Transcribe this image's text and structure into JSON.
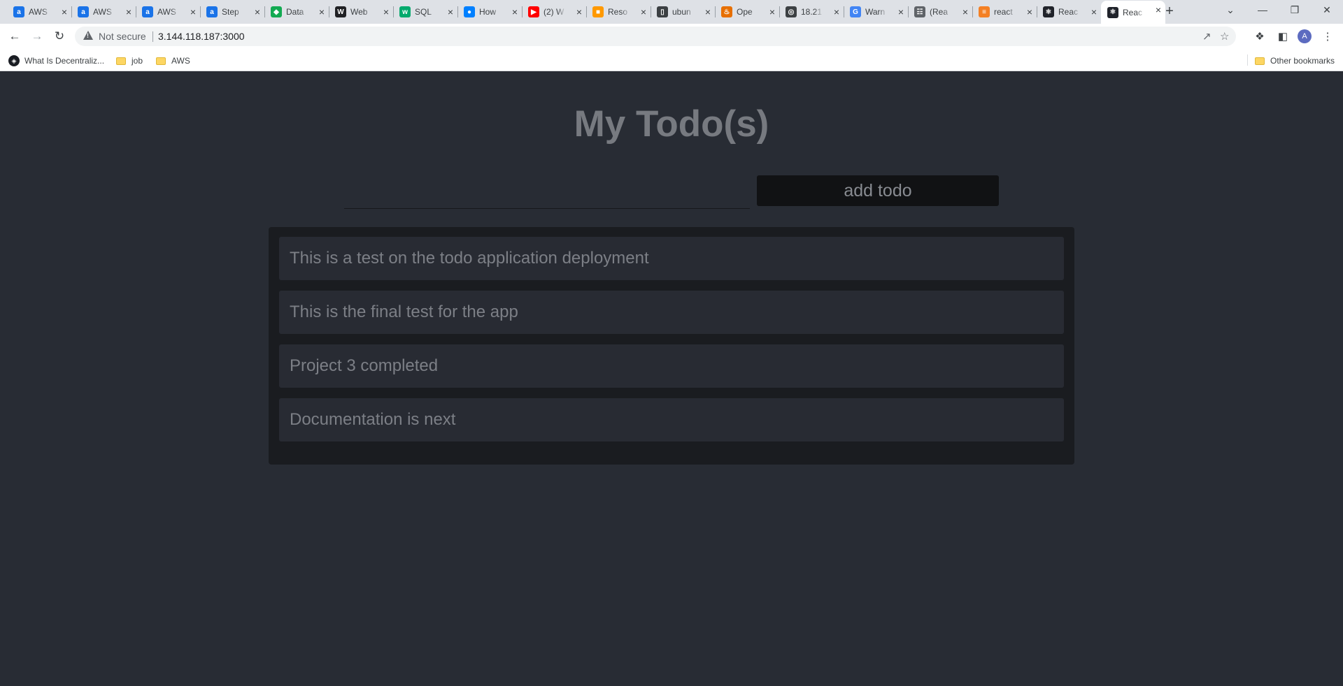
{
  "browser": {
    "tabs": [
      {
        "title": "AWS",
        "icon": "aws-icon",
        "color": "#1a73e8"
      },
      {
        "title": "AWS",
        "icon": "aws-icon",
        "color": "#1a73e8"
      },
      {
        "title": "AWS",
        "icon": "aws-icon",
        "color": "#1a73e8"
      },
      {
        "title": "Step",
        "icon": "aws-icon",
        "color": "#1a73e8"
      },
      {
        "title": "Data",
        "icon": "mongodb-icon",
        "color": "#13aa52"
      },
      {
        "title": "Web",
        "icon": "wikipedia-icon",
        "color": "#202124"
      },
      {
        "title": "SQL",
        "icon": "w3schools-icon",
        "color": "#04aa6d"
      },
      {
        "title": "How",
        "icon": "digitalocean-icon",
        "color": "#0080ff"
      },
      {
        "title": "(2) W",
        "icon": "youtube-icon",
        "color": "#ff0000"
      },
      {
        "title": "Reso",
        "icon": "aws-box-icon",
        "color": "#ff9900"
      },
      {
        "title": "ubun",
        "icon": "document-icon",
        "color": "#3c4043"
      },
      {
        "title": "Ope",
        "icon": "java-icon",
        "color": "#e76f00"
      },
      {
        "title": "18.21",
        "icon": "globe-icon",
        "color": "#3c4043"
      },
      {
        "title": "Warn",
        "icon": "google-icon",
        "color": "#4285f4"
      },
      {
        "title": "(Rea",
        "icon": "network-icon",
        "color": "#5f6368"
      },
      {
        "title": "react",
        "icon": "stackoverflow-icon",
        "color": "#f48024"
      },
      {
        "title": "Reac",
        "icon": "react-icon",
        "color": "#20232a"
      },
      {
        "title": "Reac",
        "icon": "react-icon",
        "color": "#20232a"
      }
    ],
    "active_tab": 17,
    "address": {
      "security_label": "Not secure",
      "url": "3.144.118.187:3000"
    },
    "profile_initial": "A",
    "bookmarks": [
      {
        "label": "What Is Decentraliz...",
        "type": "site"
      },
      {
        "label": "job",
        "type": "folder"
      },
      {
        "label": "AWS",
        "type": "folder"
      }
    ],
    "other_bookmarks": "Other bookmarks"
  },
  "app": {
    "title": "My Todo(s)",
    "input_value": "",
    "add_button_label": "add todo",
    "todos": [
      "This is a test on the todo application deployment",
      "This is the final test for the app",
      "Project 3 completed",
      "Documentation is next"
    ]
  }
}
